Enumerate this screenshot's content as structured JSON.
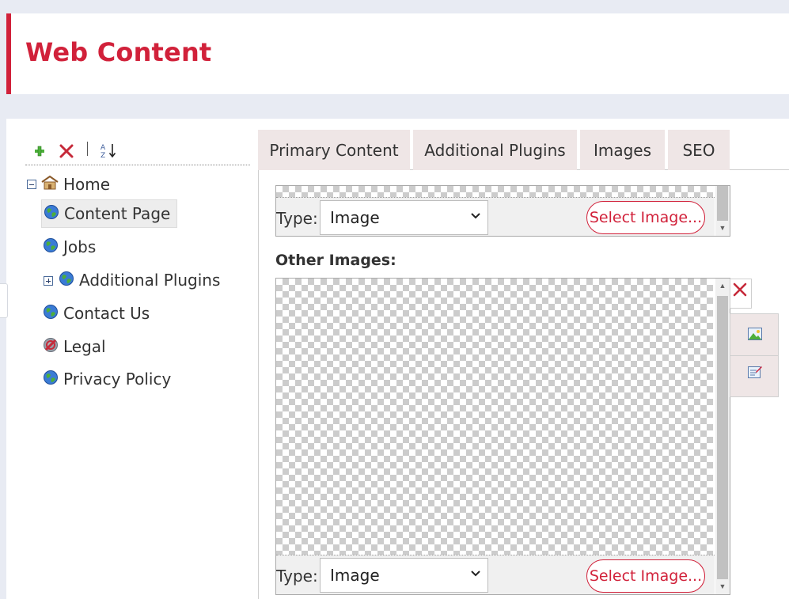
{
  "header": {
    "title": "Web Content"
  },
  "toolbar": {
    "add_icon": "plus-icon",
    "delete_icon": "close-icon",
    "sort_icon": "sort-az-icon",
    "sort_glyph_a": "A",
    "sort_glyph_z": "Z"
  },
  "tree": {
    "root": {
      "label": "Home",
      "expanded": true
    },
    "items": [
      {
        "label": "Content Page",
        "selected": true,
        "icon": "globe-icon"
      },
      {
        "label": "Jobs",
        "icon": "globe-icon"
      },
      {
        "label": "Additional Plugins",
        "icon": "globe-icon",
        "expandable": true
      },
      {
        "label": "Contact Us",
        "icon": "globe-icon"
      },
      {
        "label": "Legal",
        "icon": "globe-disabled-icon"
      },
      {
        "label": "Privacy Policy",
        "icon": "globe-icon"
      }
    ]
  },
  "tabs": [
    {
      "label": "Primary Content"
    },
    {
      "label": "Additional Plugins"
    },
    {
      "label": "Images",
      "active": true
    },
    {
      "label": "SEO"
    }
  ],
  "primary_image": {
    "type_label": "Type:",
    "type_value": "Image",
    "select_button": "Select Image..."
  },
  "other_images": {
    "label": "Other Images:",
    "type_label": "Type:",
    "type_value": "Image",
    "select_button": "Select Image..."
  },
  "colors": {
    "accent": "#d1213a",
    "tab_bg": "#efe6e6",
    "page_bg": "#e8ebf3"
  }
}
